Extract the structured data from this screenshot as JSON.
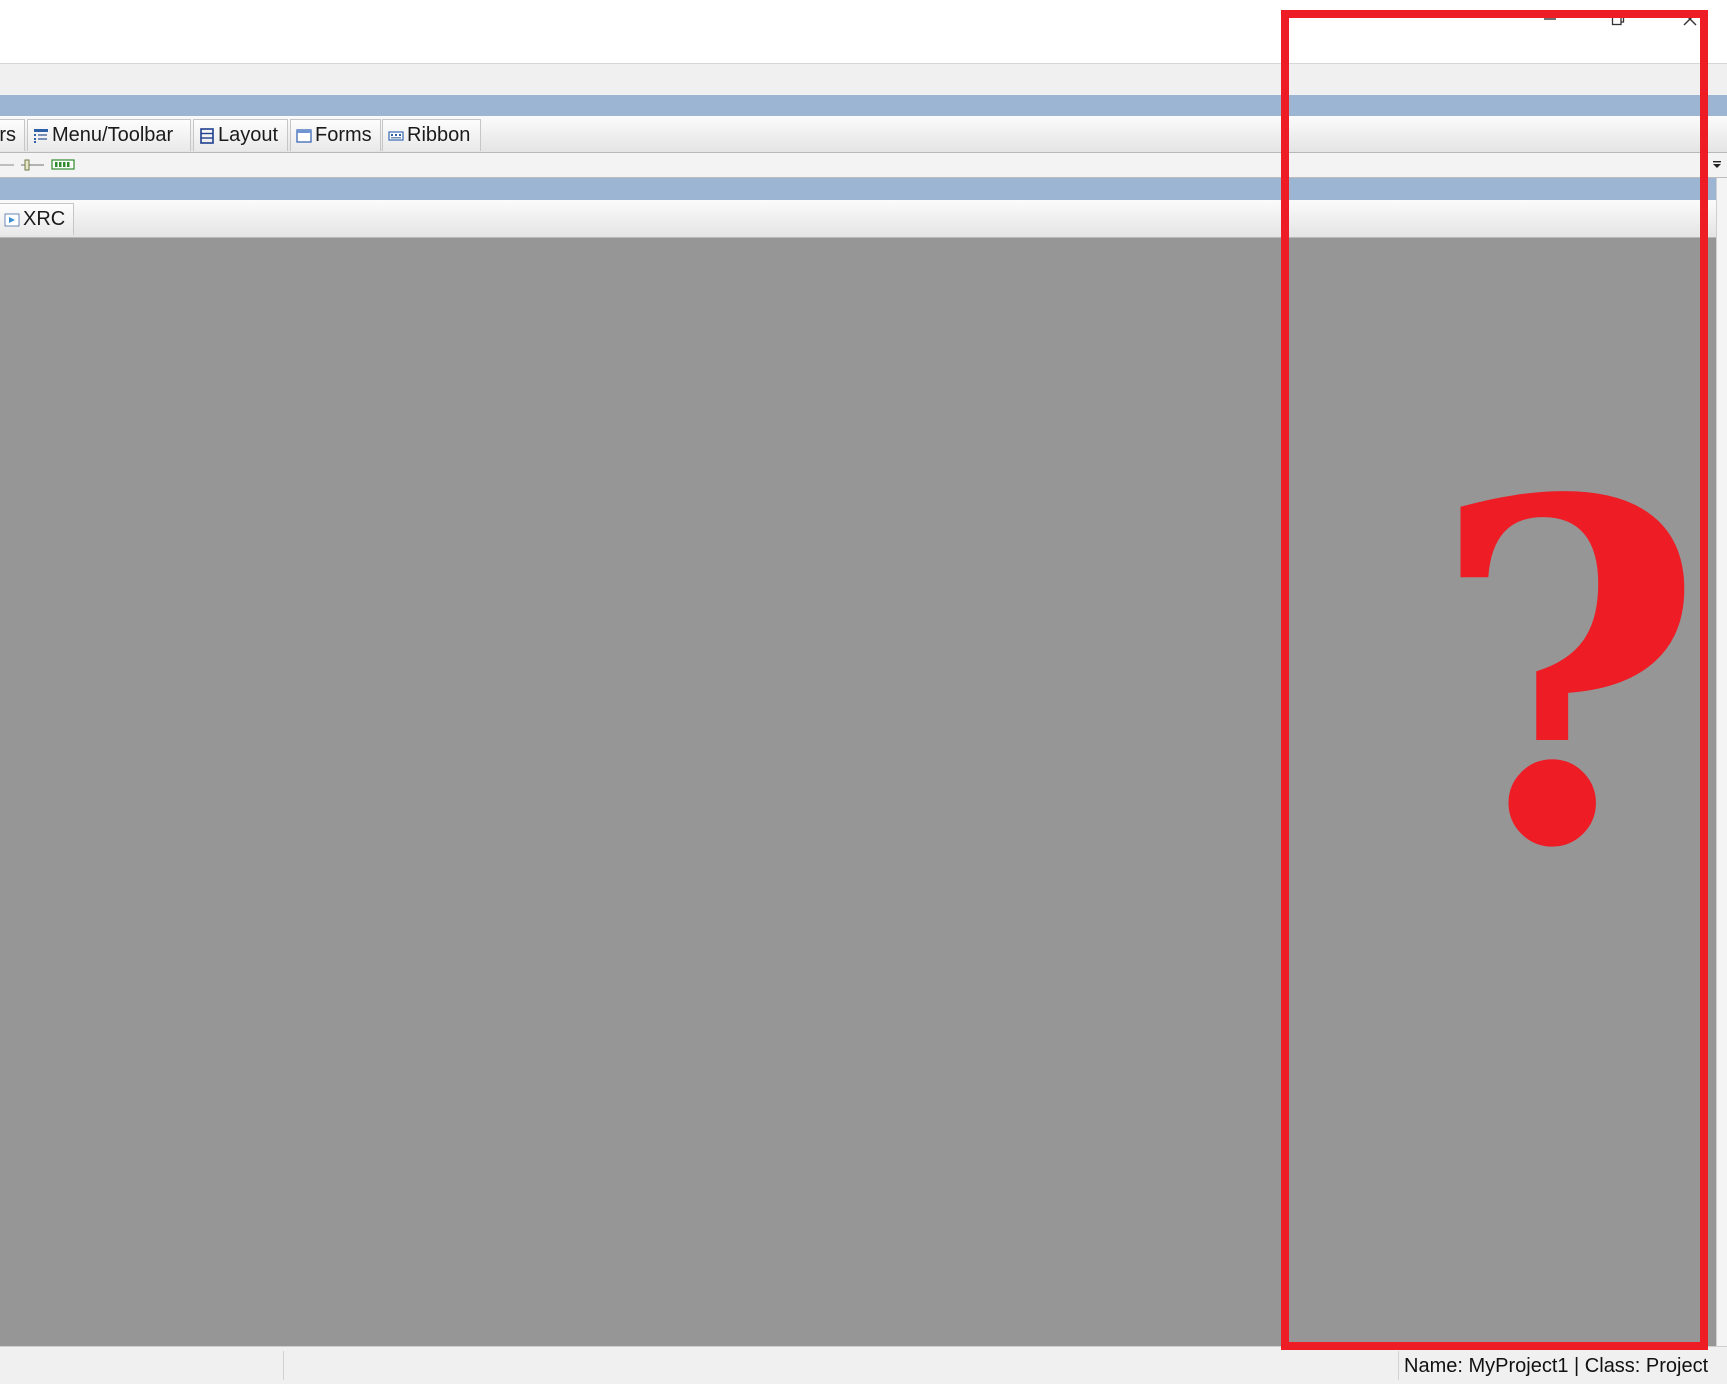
{
  "window": {
    "buttons": [
      "minimize",
      "restore",
      "close"
    ]
  },
  "toolbar_tabs": [
    {
      "label": "rs",
      "icon": "component-icon"
    },
    {
      "label": "Menu/Toolbar",
      "icon": "menu-toolbar-icon"
    },
    {
      "label": "Layout",
      "icon": "layout-icon"
    },
    {
      "label": "Forms",
      "icon": "forms-icon"
    },
    {
      "label": "Ribbon",
      "icon": "ribbon-icon"
    }
  ],
  "editor_tabs": [
    {
      "label": "XRC",
      "icon": "xrc-icon"
    }
  ],
  "status": {
    "text": "Name: MyProject1 | Class: Project"
  },
  "overlay": {
    "symbol": "?",
    "color": "#ee1c25"
  },
  "colors": {
    "title_strip": "#9bb5d3",
    "canvas": "#969696",
    "status_bar": "#f0f0f0"
  }
}
